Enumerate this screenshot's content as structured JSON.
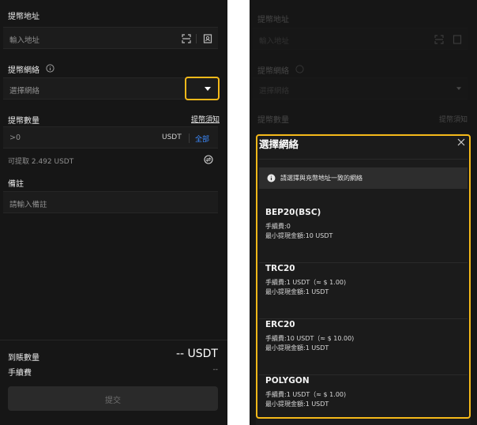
{
  "left": {
    "address_label": "提幣地址",
    "address_placeholder": "輸入地址",
    "network_label": "提幣網絡",
    "network_placeholder": "選擇網絡",
    "amount_label": "提幣數量",
    "notice_link": "提幣須知",
    "amount_placeholder": ">0",
    "amount_unit": "USDT",
    "all_button": "全部",
    "available": "可提取 2.492 USDT",
    "note_label": "備註",
    "note_placeholder": "請輸入備註",
    "receive_label": "到賬數量",
    "receive_value": "-- USDT",
    "fee_label": "手續費",
    "fee_value": "--",
    "submit_label": "提交"
  },
  "right": {
    "address_label": "提幣地址",
    "address_placeholder": "輸入地址",
    "network_label": "提幣網絡",
    "network_placeholder": "選擇網絡",
    "amount_label": "提幣數量",
    "notice_link": "提幣須知",
    "sheet": {
      "title": "選擇網絡",
      "info": "請選擇與充幣地址一致的網絡",
      "networks": [
        {
          "name": "BEP20(BSC)",
          "fee": "手續費:0",
          "min": "最小提現金額:10 USDT"
        },
        {
          "name": "TRC20",
          "fee": "手續費:1 USDT（≈ $ 1.00)",
          "min": "最小提現金額:1 USDT"
        },
        {
          "name": "ERC20",
          "fee": "手續費:10 USDT（≈ $ 10.00)",
          "min": "最小提現金額:1 USDT"
        },
        {
          "name": "POLYGON",
          "fee": "手續費:1 USDT（≈ $ 1.00)",
          "min": "最小提現金額:1 USDT"
        }
      ]
    }
  },
  "colors": {
    "highlight": "#f5b91a",
    "link": "#3d8bff",
    "background": "#161616"
  },
  "icons": [
    "scan-icon",
    "address-book-icon",
    "info-icon",
    "dropdown-arrow-icon",
    "swap-icon",
    "close-icon"
  ]
}
